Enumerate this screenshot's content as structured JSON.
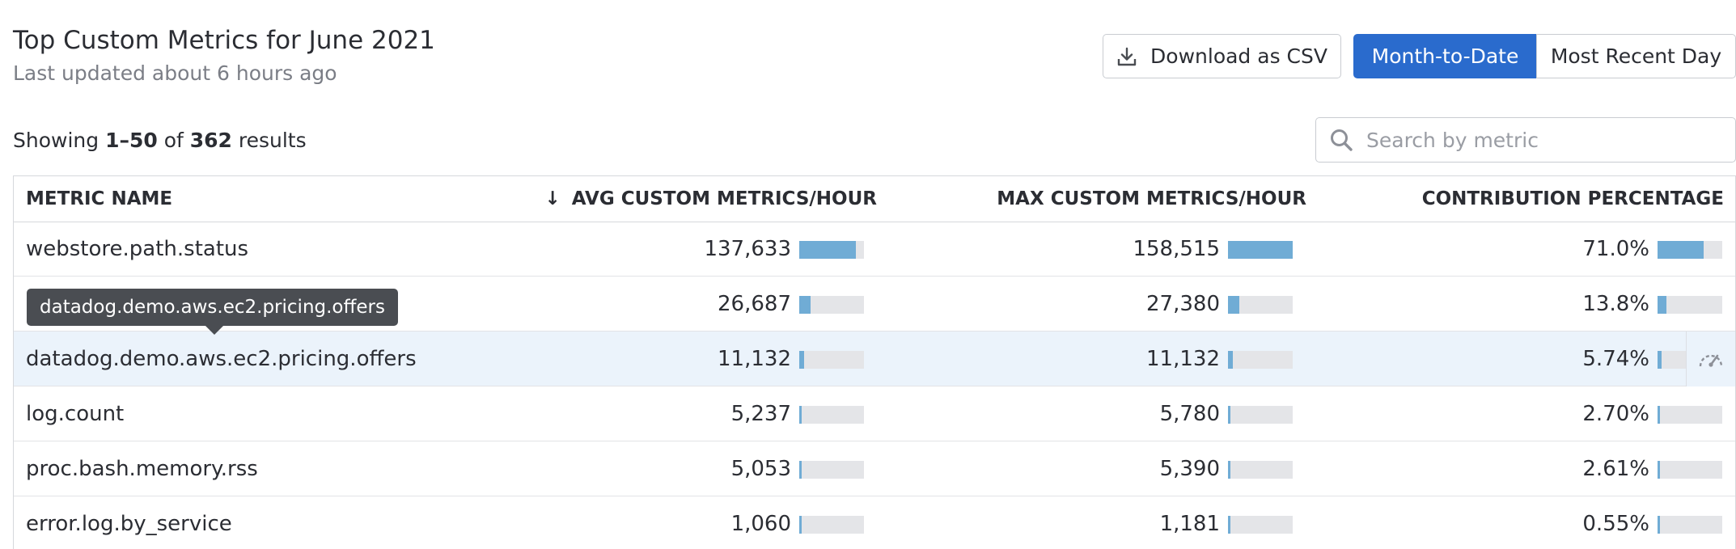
{
  "header": {
    "title": "Top Custom Metrics for June 2021",
    "subtitle": "Last updated about 6 hours ago"
  },
  "toolbar": {
    "download_label": "Download as CSV",
    "download_icon": "download-icon",
    "range_options": [
      "Month-to-Date",
      "Most Recent Day"
    ],
    "range_selected": "Month-to-Date",
    "accent_color": "#2a6bcd"
  },
  "results": {
    "prefix": "Showing ",
    "range": "1–50",
    "middle": " of ",
    "total": "362",
    "suffix": " results"
  },
  "search": {
    "placeholder": "Search by metric",
    "value": "",
    "icon": "search-icon"
  },
  "table": {
    "columns": {
      "name": "METRIC NAME",
      "avg": "AVG CUSTOM METRICS/HOUR",
      "max": "MAX CUSTOM METRICS/HOUR",
      "contrib": "CONTRIBUTION PERCENTAGE"
    },
    "sort": {
      "column": "avg",
      "direction": "desc",
      "icon": "arrow-down-icon"
    },
    "bar_color": "#70acd5",
    "highlight_color": "#ebf3fb",
    "rows": [
      {
        "name": "webstore.path.status",
        "avg": "137,633",
        "avg_ratio": 0.87,
        "max": "158,515",
        "max_ratio": 1.0,
        "contrib": "71.0%",
        "contrib_ratio": 0.71
      },
      {
        "name": "",
        "avg": "26,687",
        "avg_ratio": 0.17,
        "max": "27,380",
        "max_ratio": 0.17,
        "contrib": "13.8%",
        "contrib_ratio": 0.14
      },
      {
        "name": "datadog.demo.aws.ec2.pricing.offers",
        "avg": "11,132",
        "avg_ratio": 0.07,
        "max": "11,132",
        "max_ratio": 0.07,
        "contrib": "5.74%",
        "contrib_ratio": 0.06,
        "highlighted": true
      },
      {
        "name": "log.count",
        "avg": "5,237",
        "avg_ratio": 0.03,
        "max": "5,780",
        "max_ratio": 0.03,
        "contrib": "2.70%",
        "contrib_ratio": 0.03
      },
      {
        "name": "proc.bash.memory.rss",
        "avg": "5,053",
        "avg_ratio": 0.03,
        "max": "5,390",
        "max_ratio": 0.03,
        "contrib": "2.61%",
        "contrib_ratio": 0.03
      },
      {
        "name": "error.log.by_service",
        "avg": "1,060",
        "avg_ratio": 0.01,
        "max": "1,181",
        "max_ratio": 0.01,
        "contrib": "0.55%",
        "contrib_ratio": 0.01
      }
    ]
  },
  "row_action": {
    "icon": "gauge-icon"
  },
  "tooltip": {
    "text": "datadog.demo.aws.ec2.pricing.offers"
  }
}
